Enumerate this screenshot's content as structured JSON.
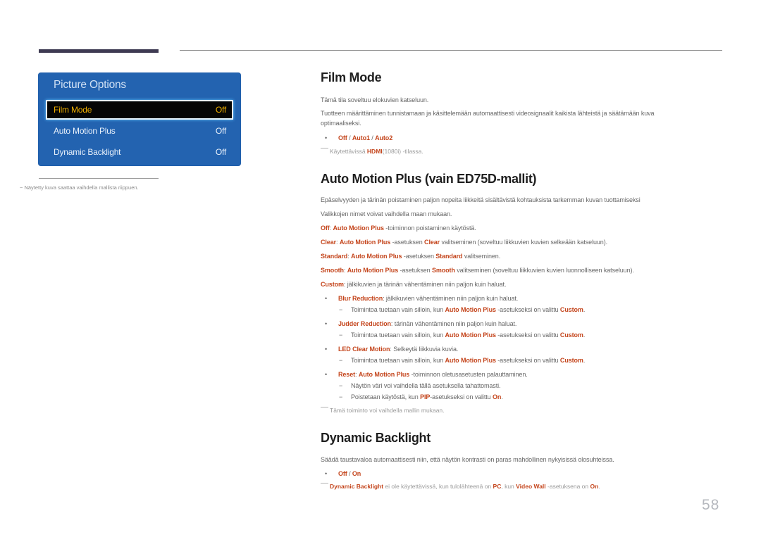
{
  "sidebar": {
    "panel_title": "Picture Options",
    "items": [
      {
        "label": "Film Mode",
        "value": "Off",
        "selected": true
      },
      {
        "label": "Auto Motion Plus",
        "value": "Off",
        "selected": false
      },
      {
        "label": "Dynamic Backlight",
        "value": "Off",
        "selected": false
      }
    ],
    "note": "−  Näytetty kuva saattaa vaihdella mallista riippuen."
  },
  "film_mode": {
    "title": "Film Mode",
    "p1": "Tämä tila soveltuu elokuvien katseluun.",
    "p2a": "Tuotteen määrittäminen tunnistamaan ja käsittelemään automaattisesti videosignaalit kaikista lähteistä ja säätämään kuva",
    "p2b": "optimaaliseksi.",
    "options": [
      "Off",
      "Auto1",
      "Auto2"
    ],
    "sep": " / ",
    "note_pre": "Käytettävissä ",
    "note_hl": "HDMI",
    "note_post": "(1080i) -tilassa."
  },
  "amp": {
    "title": "Auto Motion Plus (vain ED75D-mallit)",
    "p1": "Epäselvyyden ja tärinän poistaminen paljon nopeita liikkeitä sisältävistä kohtauksista tarkemman kuvan tuottamiseksi",
    "p2": "Valikkojen nimet voivat vaihdella maan mukaan.",
    "amp": "Auto Motion Plus",
    "off_hl": "Off",
    "off_text": " -toiminnon poistaminen käytöstä.",
    "clear_hl": "Clear",
    "clear_mid": " -asetuksen ",
    "clear_text": " valitseminen (soveltuu liikkuvien kuvien selkeään katseluun).",
    "standard_hl": "Standard",
    "standard_text": " valitseminen.",
    "smooth_hl": "Smooth",
    "smooth_text": " valitseminen (soveltuu liikkuvien kuvien luonnolliseen katseluun).",
    "custom_hl": "Custom",
    "custom_text": ": jälkikuvien ja tärinän vähentäminen niin paljon kuin haluat.",
    "colon": ": ",
    "blur_hl": "Blur Reduction",
    "blur_text": ": jälkikuvien vähentäminen niin paljon kuin haluat.",
    "judder_hl": "Judder Reduction",
    "judder_text": ": tärinän vähentäminen niin paljon kuin haluat.",
    "led_hl": "LED Clear Motion",
    "led_text": ": Selkeytä liikkuvia kuvia.",
    "sub_pre": "Toimintoa tuetaan vain silloin, kun ",
    "sub_mid": " -asetukseksi on valittu ",
    "sub_end": ".",
    "reset_hl": "Reset",
    "reset_text": " -toiminnon oletusasetusten palauttaminen.",
    "reset_sub1": "Näytön väri voi vaihdella tällä asetuksella tahattomasti.",
    "reset_sub2_pre": "Poistetaan käytöstä, kun ",
    "pip_hl": "PIP",
    "reset_sub2_mid": "-asetukseksi on valittu ",
    "on_hl": "On",
    "note": "Tämä toiminto voi vaihdella mallin mukaan.",
    "bullet": "•",
    "dash": "−"
  },
  "db": {
    "title": "Dynamic Backlight",
    "p1": "Säädä taustavaloa automaattisesti niin, että näytön kontrasti on paras mahdollinen nykyisissä olosuhteissa.",
    "opt_off": "Off",
    "opt_on": "On",
    "sep": " / ",
    "note_hl1": "Dynamic Backlight",
    "note_t1": " ei ole käytettävissä, kun tulolähteenä on ",
    "note_hl2": "PC",
    "note_t2": ", kun ",
    "note_hl3": "Video Wall",
    "note_t3": " -asetuksena on ",
    "note_hl4": "On",
    "note_t4": "."
  },
  "page_number": "58",
  "colors": {
    "accent": "#c4451c",
    "panel": "#2363b0",
    "selected_text": "#f0b000"
  }
}
